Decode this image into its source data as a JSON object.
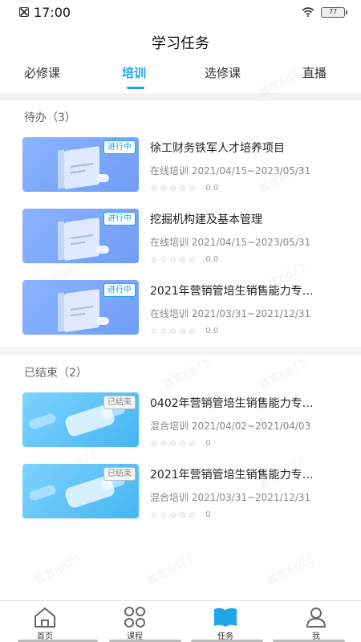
{
  "status_bar": {
    "time": "17:00",
    "battery": "77"
  },
  "header": {
    "title": "学习任务"
  },
  "tabs": [
    {
      "label": "必修课",
      "active": false
    },
    {
      "label": "培训",
      "active": true
    },
    {
      "label": "选修课",
      "active": false
    },
    {
      "label": "直播",
      "active": false
    }
  ],
  "todo": {
    "title": "待办（3）",
    "items": [
      {
        "badge": "进行中",
        "title": "徐工财务铁军人才培养项目",
        "meta": "在线培训 2021/04/15~2023/05/31",
        "stars": "☆☆☆☆☆",
        "score": "0.0"
      },
      {
        "badge": "进行中",
        "title": "挖掘机构建及基本管理",
        "meta": "在线培训 2021/04/15~2023/05/31",
        "stars": "☆☆☆☆☆",
        "score": "0.0"
      },
      {
        "badge": "进行中",
        "title": "2021年营销管培生销售能力专…",
        "meta": "在线培训 2021/03/31~2021/12/31",
        "stars": "☆☆☆☆☆",
        "score": "0.0"
      }
    ]
  },
  "ended": {
    "title": "已结束（2）",
    "items": [
      {
        "badge": "已结束",
        "title": "0402年营销管培生销售能力专…",
        "meta": "混合培训 2021/04/02~2021/04/03",
        "stars": "☆☆☆☆☆",
        "score": "0"
      },
      {
        "badge": "已结束",
        "title": "2021年营销管培生销售能力专…",
        "meta": "混合培训 2021/03/31~2021/12/31",
        "stars": "☆☆☆☆☆",
        "score": "0"
      }
    ]
  },
  "bottom_nav": [
    {
      "label": "首页",
      "icon": "home-icon"
    },
    {
      "label": "课程",
      "icon": "course-icon"
    },
    {
      "label": "任务",
      "icon": "book-icon"
    },
    {
      "label": "我",
      "icon": "user-icon"
    }
  ],
  "watermark": "慕雪6673",
  "colors": {
    "accent": "#1fa6e8"
  }
}
